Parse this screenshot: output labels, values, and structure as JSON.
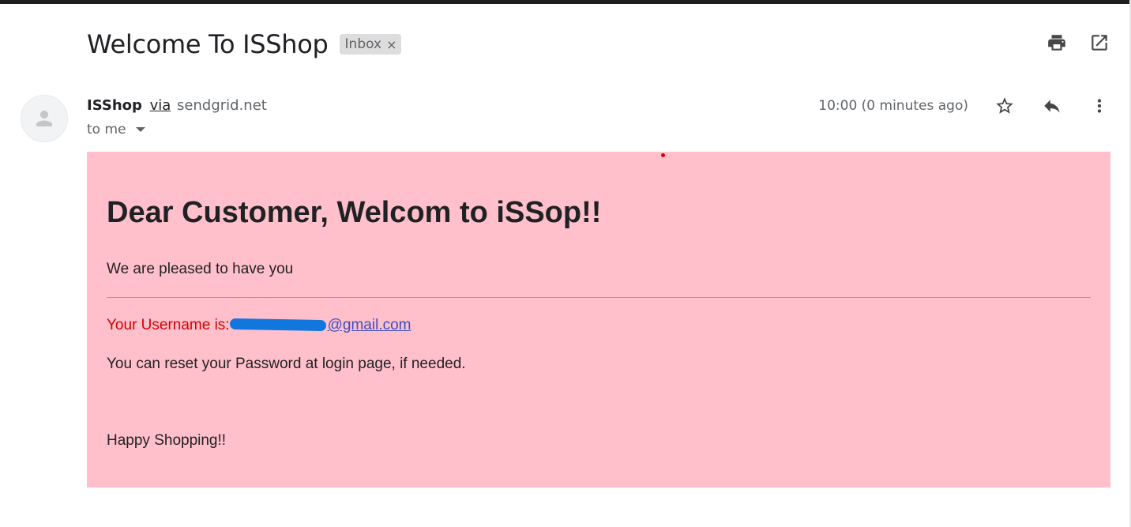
{
  "email": {
    "subject": "Welcome To ISShop",
    "label": "Inbox",
    "label_close": "×",
    "sender_name": "ISShop",
    "via_text": "via",
    "via_domain": "sendgrid.net",
    "recipient": "to me",
    "timestamp": "10:00 (0 minutes ago)"
  },
  "body": {
    "title": "Dear Customer, Welcom to iSSop!!",
    "greeting": "We are pleased to have you",
    "username_label": "Your Username is:",
    "username_email_visible": "@gmail.com",
    "reset_text": "You can reset your Password at login page, if needed.",
    "closing": "Happy Shopping!!",
    "background_color": "#ffc0cb",
    "label_color": "#d50000"
  },
  "icons": {
    "print": "print-icon",
    "open_new_window": "open-in-new-window-icon",
    "star": "star-icon",
    "reply": "reply-icon",
    "more": "more-vert-icon",
    "avatar": "person-avatar-icon"
  }
}
